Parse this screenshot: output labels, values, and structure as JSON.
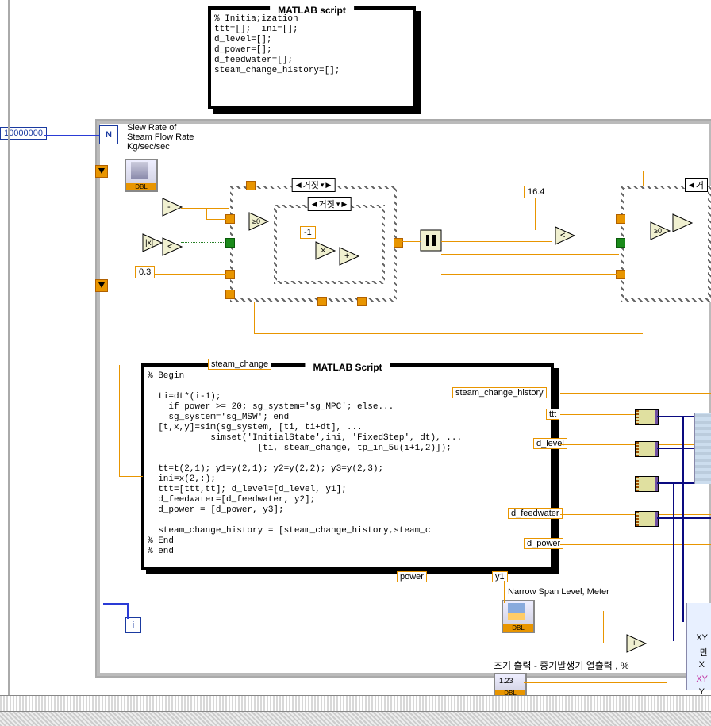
{
  "loop": {
    "iterations_const": "10000000",
    "n_label": "N",
    "i_label": "i"
  },
  "slew_label": "Slew Rate of\nSteam Flow Rate\nKg/sec/sec",
  "script1": {
    "title": "MATLAB script",
    "code": "% Initia;ization\nttt=[];  ini=[];\nd_level=[];\nd_power=[];\nd_feedwater=[];\nsteam_change_history=[];"
  },
  "script2": {
    "title": "MATLAB Script",
    "in_terminal": "steam_change",
    "code": "% Begin\n\n  ti=dt*(i-1);\n    if power >= 20; sg_system='sg_MPC'; else...\n    sg_system='sg_MSW'; end\n  [t,x,y]=sim(sg_system, [ti, ti+dt], ...\n            simset('InitialState',ini, 'FixedStep', dt), ...\n                     [ti, steam_change, tp_in_5u(i+1,2)]);\n\n  tt=t(2,1); y1=y(2,1); y2=y(2,2); y3=y(2,3);\n  ini=x(2,:);\n  ttt=[ttt,tt]; d_level=[d_level, y1];\n  d_feedwater=[d_feedwater, y2];\n  d_power = [d_power, y3];\n\n  steam_change_history = [steam_change_history,steam_c\n% End\n% end"
  },
  "case1": {
    "selector": "거짓"
  },
  "case1_inner": {
    "selector": "거짓"
  },
  "case2": {
    "selector": "거"
  },
  "consts": {
    "c03": "0.3",
    "c164": "16.4",
    "cmneg1": "-1"
  },
  "out_terms": {
    "power": "power",
    "y1": "y1",
    "steam_change_history": "steam_change_history",
    "ttt": "ttt",
    "d_level": "d_level",
    "d_feedwater": "d_feedwater",
    "d_power": "d_power"
  },
  "narrow_span_label": "Narrow Span Level, Meter",
  "korean_label": "초기 출력 - 증기발생기 열출력 , %",
  "right_panel": {
    "xy_label": "XY",
    "xy2_label": "XY",
    "x_label": "X",
    "y_label": "Y",
    "extra": "만"
  },
  "dbl_tag": "DBL"
}
